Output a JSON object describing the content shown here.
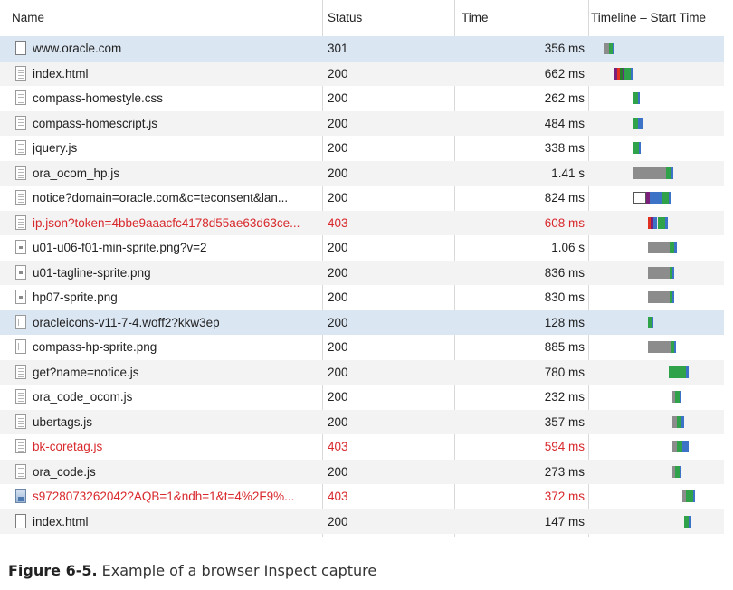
{
  "columns": {
    "name": "Name",
    "status": "Status",
    "time": "Time",
    "timeline": "Timeline – Start Time"
  },
  "rows": [
    {
      "name": "www.oracle.com",
      "status": "301",
      "time": "356 ms",
      "icon": "page-icon",
      "error": false,
      "selected": true,
      "timeline": [
        {
          "start": 16,
          "len": 5,
          "color": "#8c8c8c"
        },
        {
          "start": 21,
          "len": 4,
          "color": "#30a24a"
        },
        {
          "start": 25,
          "len": 2,
          "color": "#3c73c6"
        }
      ]
    },
    {
      "name": "index.html",
      "status": "200",
      "time": "662 ms",
      "icon": "document-icon",
      "error": false,
      "selected": false,
      "timeline": [
        {
          "start": 27,
          "len": 3,
          "color": "#7a1f7a"
        },
        {
          "start": 30,
          "len": 3,
          "color": "#e03020"
        },
        {
          "start": 33,
          "len": 3,
          "color": "#2a7d2a"
        },
        {
          "start": 36,
          "len": 2,
          "color": "#6a2a8a"
        },
        {
          "start": 38,
          "len": 7,
          "color": "#30a24a"
        },
        {
          "start": 45,
          "len": 3,
          "color": "#3c73c6"
        }
      ]
    },
    {
      "name": "compass-homestyle.css",
      "status": "200",
      "time": "262 ms",
      "icon": "document-icon",
      "error": false,
      "selected": false,
      "timeline": [
        {
          "start": 48,
          "len": 5,
          "color": "#30a24a"
        },
        {
          "start": 53,
          "len": 2,
          "color": "#3c73c6"
        }
      ]
    },
    {
      "name": "compass-homescript.js",
      "status": "200",
      "time": "484 ms",
      "icon": "document-icon",
      "error": false,
      "selected": false,
      "timeline": [
        {
          "start": 48,
          "len": 5,
          "color": "#30a24a"
        },
        {
          "start": 53,
          "len": 6,
          "color": "#3c73c6"
        }
      ]
    },
    {
      "name": "jquery.js",
      "status": "200",
      "time": "338 ms",
      "icon": "document-icon",
      "error": false,
      "selected": false,
      "timeline": [
        {
          "start": 48,
          "len": 6,
          "color": "#30a24a"
        },
        {
          "start": 54,
          "len": 2,
          "color": "#3c73c6"
        }
      ]
    },
    {
      "name": "ora_ocom_hp.js",
      "status": "200",
      "time": "1.41 s",
      "icon": "document-icon",
      "error": false,
      "selected": false,
      "timeline": [
        {
          "start": 48,
          "len": 36,
          "color": "#8c8c8c"
        },
        {
          "start": 84,
          "len": 5,
          "color": "#30a24a"
        },
        {
          "start": 89,
          "len": 3,
          "color": "#3c73c6"
        }
      ]
    },
    {
      "name": "notice?domain=oracle.com&c=teconsent&lan...",
      "status": "200",
      "time": "824 ms",
      "icon": "document-icon",
      "error": false,
      "selected": false,
      "timeline": [
        {
          "start": 48,
          "len": 14,
          "color": "#ffffff",
          "outline": true
        },
        {
          "start": 62,
          "len": 4,
          "color": "#7a1f7a"
        },
        {
          "start": 66,
          "len": 13,
          "color": "#3c73c6"
        },
        {
          "start": 79,
          "len": 8,
          "color": "#30a24a"
        },
        {
          "start": 87,
          "len": 3,
          "color": "#3c73c6"
        }
      ]
    },
    {
      "name": "ip.json?token=4bbe9aaacfc4178d55ae63d63ce...",
      "status": "403",
      "time": "608 ms",
      "icon": "document-icon",
      "error": true,
      "selected": false,
      "timeline": [
        {
          "start": 64,
          "len": 3,
          "color": "#e03020"
        },
        {
          "start": 67,
          "len": 3,
          "color": "#7a1f7a"
        },
        {
          "start": 70,
          "len": 4,
          "color": "#3c73c6"
        },
        {
          "start": 74,
          "len": 1,
          "color": "#e8e8e8"
        },
        {
          "start": 75,
          "len": 8,
          "color": "#30a24a"
        },
        {
          "start": 83,
          "len": 3,
          "color": "#3c73c6"
        }
      ]
    },
    {
      "name": "u01-u06-f01-min-sprite.png?v=2",
      "status": "200",
      "time": "1.06 s",
      "icon": "image-icon",
      "error": false,
      "selected": false,
      "timeline": [
        {
          "start": 64,
          "len": 24,
          "color": "#8c8c8c"
        },
        {
          "start": 88,
          "len": 5,
          "color": "#30a24a"
        },
        {
          "start": 93,
          "len": 3,
          "color": "#3c73c6"
        }
      ]
    },
    {
      "name": "u01-tagline-sprite.png",
      "status": "200",
      "time": "836 ms",
      "icon": "image-icon",
      "error": false,
      "selected": false,
      "timeline": [
        {
          "start": 64,
          "len": 24,
          "color": "#8c8c8c"
        },
        {
          "start": 88,
          "len": 3,
          "color": "#30a24a"
        },
        {
          "start": 91,
          "len": 2,
          "color": "#3c73c6"
        }
      ]
    },
    {
      "name": "hp07-sprite.png",
      "status": "200",
      "time": "830 ms",
      "icon": "image-icon",
      "error": false,
      "selected": false,
      "timeline": [
        {
          "start": 64,
          "len": 24,
          "color": "#8c8c8c"
        },
        {
          "start": 88,
          "len": 3,
          "color": "#30a24a"
        },
        {
          "start": 91,
          "len": 2,
          "color": "#3c73c6"
        }
      ]
    },
    {
      "name": "oracleicons-v11-7-4.woff2?kkw3ep",
      "status": "200",
      "time": "128 ms",
      "icon": "font-icon",
      "error": false,
      "selected": true,
      "timeline": [
        {
          "start": 64,
          "len": 4,
          "color": "#30a24a"
        },
        {
          "start": 68,
          "len": 2,
          "color": "#3c73c6"
        }
      ]
    },
    {
      "name": "compass-hp-sprite.png",
      "status": "200",
      "time": "885 ms",
      "icon": "font-icon",
      "error": false,
      "selected": false,
      "timeline": [
        {
          "start": 64,
          "len": 26,
          "color": "#8c8c8c"
        },
        {
          "start": 90,
          "len": 3,
          "color": "#30a24a"
        },
        {
          "start": 93,
          "len": 2,
          "color": "#3c73c6"
        }
      ]
    },
    {
      "name": "get?name=notice.js",
      "status": "200",
      "time": "780 ms",
      "icon": "document-icon",
      "error": false,
      "selected": false,
      "timeline": [
        {
          "start": 87,
          "len": 19,
          "color": "#30a24a"
        },
        {
          "start": 106,
          "len": 3,
          "color": "#3c73c6"
        }
      ]
    },
    {
      "name": "ora_code_ocom.js",
      "status": "200",
      "time": "232 ms",
      "icon": "document-icon",
      "error": false,
      "selected": false,
      "timeline": [
        {
          "start": 91,
          "len": 3,
          "color": "#8c8c8c"
        },
        {
          "start": 94,
          "len": 5,
          "color": "#30a24a"
        },
        {
          "start": 99,
          "len": 2,
          "color": "#3c73c6"
        }
      ]
    },
    {
      "name": "ubertags.js",
      "status": "200",
      "time": "357 ms",
      "icon": "document-icon",
      "error": false,
      "selected": false,
      "timeline": [
        {
          "start": 91,
          "len": 5,
          "color": "#8c8c8c"
        },
        {
          "start": 96,
          "len": 5,
          "color": "#30a24a"
        },
        {
          "start": 101,
          "len": 3,
          "color": "#3c73c6"
        }
      ]
    },
    {
      "name": "bk-coretag.js",
      "status": "403",
      "time": "594 ms",
      "icon": "document-icon",
      "error": true,
      "selected": false,
      "timeline": [
        {
          "start": 91,
          "len": 5,
          "color": "#8c8c8c"
        },
        {
          "start": 96,
          "len": 6,
          "color": "#30a24a"
        },
        {
          "start": 102,
          "len": 7,
          "color": "#3c73c6"
        }
      ]
    },
    {
      "name": "ora_code.js",
      "status": "200",
      "time": "273 ms",
      "icon": "document-icon",
      "error": false,
      "selected": false,
      "timeline": [
        {
          "start": 91,
          "len": 3,
          "color": "#8c8c8c"
        },
        {
          "start": 94,
          "len": 5,
          "color": "#30a24a"
        },
        {
          "start": 99,
          "len": 2,
          "color": "#3c73c6"
        }
      ]
    },
    {
      "name": "s9728073262042?AQB=1&ndh=1&t=4%2F9%...",
      "status": "403",
      "time": "372 ms",
      "icon": "picture-icon",
      "error": true,
      "selected": false,
      "timeline": [
        {
          "start": 102,
          "len": 4,
          "color": "#8c8c8c"
        },
        {
          "start": 106,
          "len": 8,
          "color": "#30a24a"
        },
        {
          "start": 114,
          "len": 2,
          "color": "#3c73c6"
        }
      ]
    },
    {
      "name": "index.html",
      "status": "200",
      "time": "147 ms",
      "icon": "page-icon",
      "error": false,
      "selected": false,
      "timeline": [
        {
          "start": 104,
          "len": 5,
          "color": "#30a24a"
        },
        {
          "start": 109,
          "len": 3,
          "color": "#3c73c6"
        }
      ]
    }
  ],
  "caption": {
    "label": "Figure 6-5.",
    "text": "Example of a browser Inspect capture"
  }
}
